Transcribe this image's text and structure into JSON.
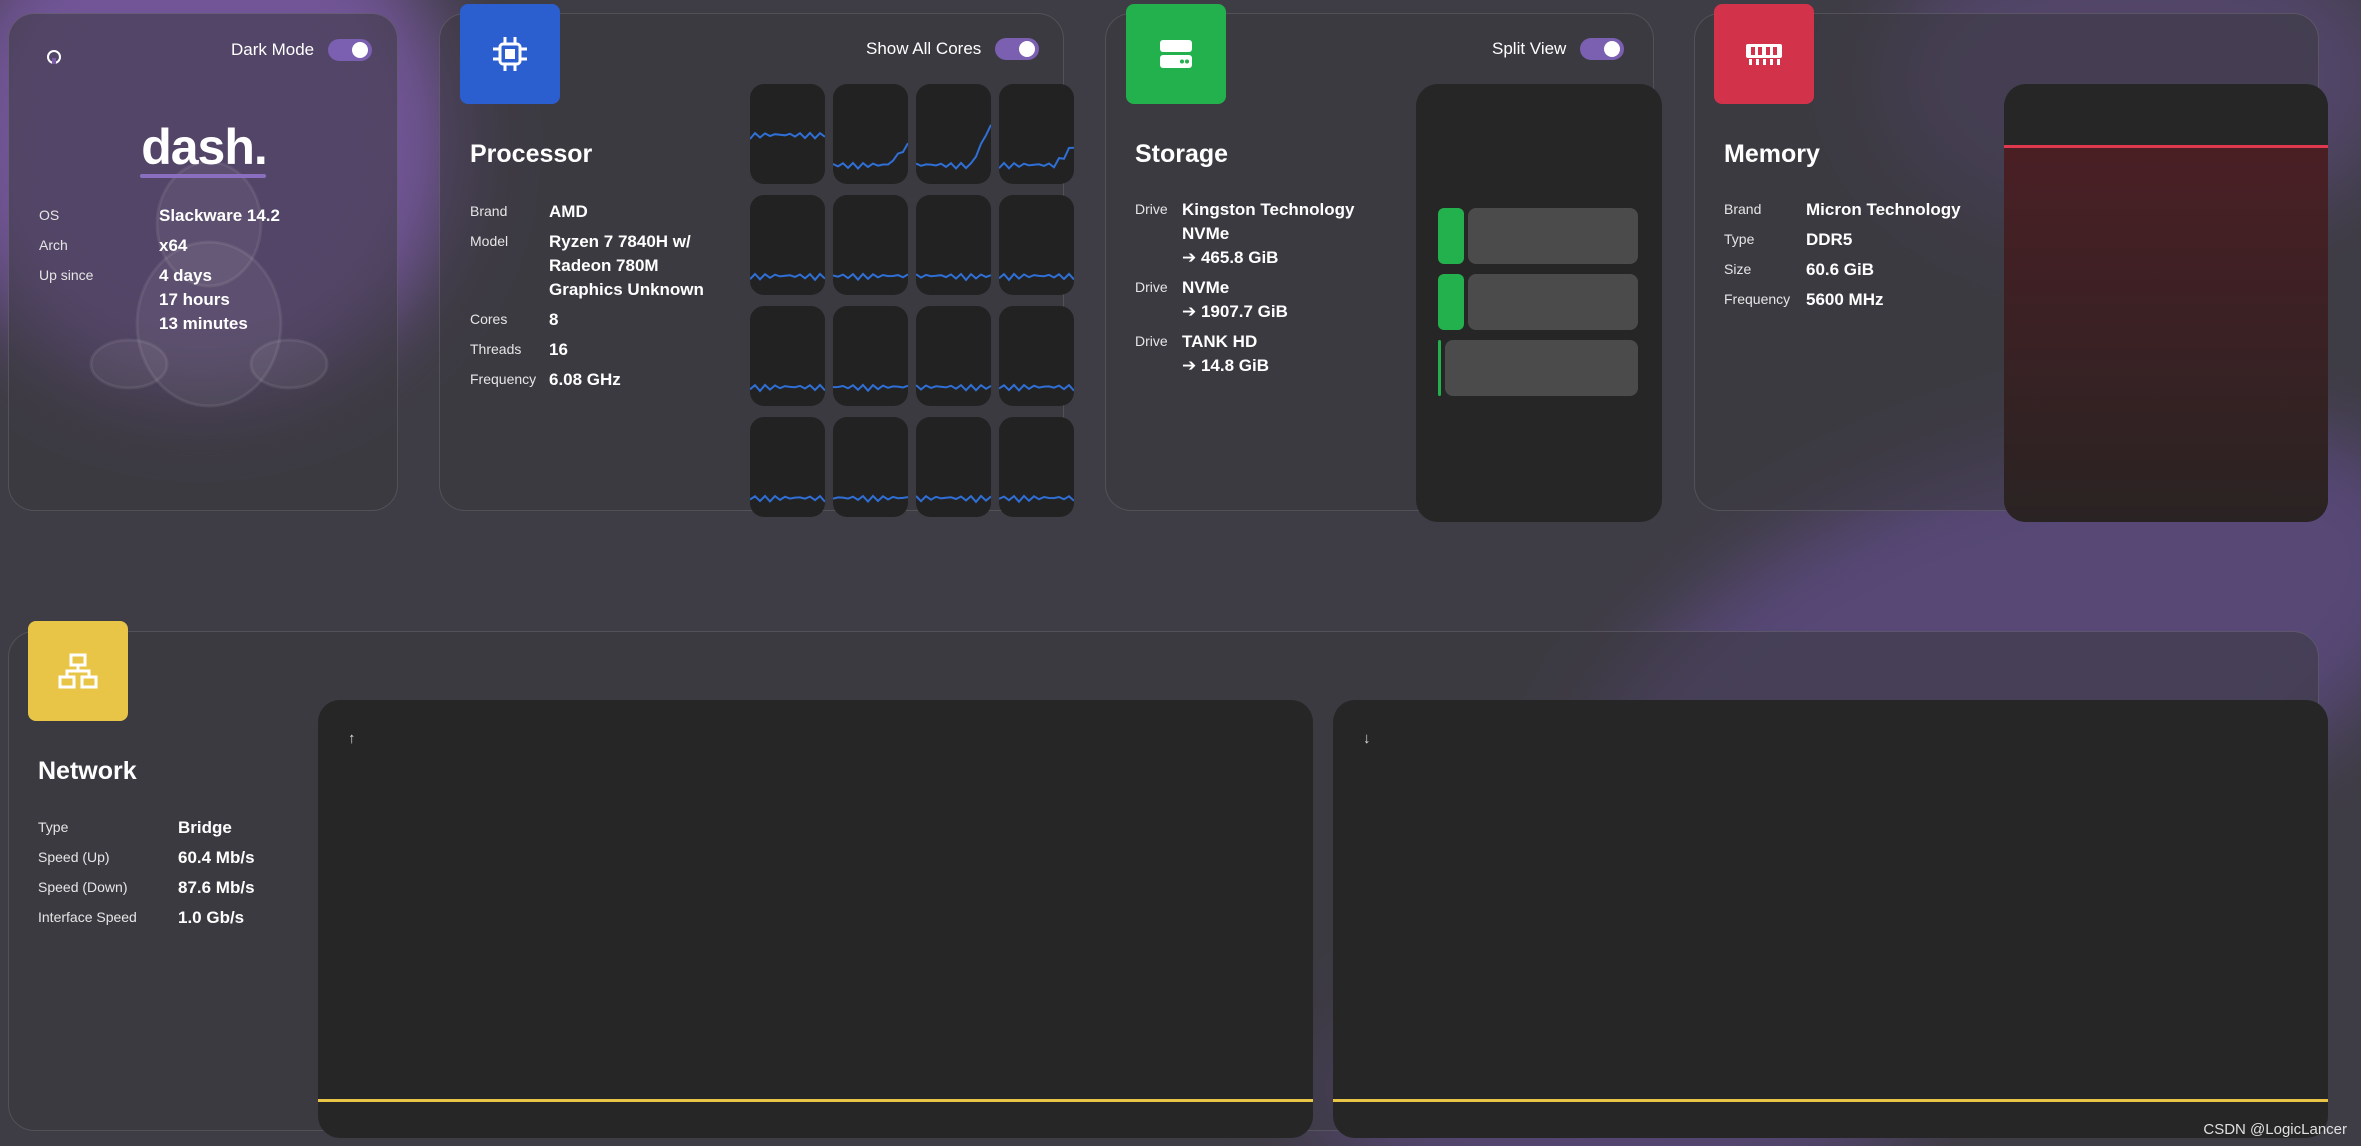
{
  "system": {
    "dark_mode_label": "Dark Mode",
    "logo": "dash.",
    "rows": [
      {
        "key": "OS",
        "value": "Slackware 14.2"
      },
      {
        "key": "Arch",
        "value": "x64"
      },
      {
        "key": "Up since",
        "value": "4 days\n17 hours\n13 minutes"
      }
    ]
  },
  "processor": {
    "title": "Processor",
    "toggle_label": "Show All Cores",
    "rows": [
      {
        "key": "Brand",
        "value": "AMD"
      },
      {
        "key": "Model",
        "value": "Ryzen 7 7840H w/\nRadeon 780M\nGraphics Unknown"
      },
      {
        "key": "Cores",
        "value": "8"
      },
      {
        "key": "Threads",
        "value": "16"
      },
      {
        "key": "Frequency",
        "value": "6.08 GHz"
      }
    ],
    "line_color": "#2f6fd6"
  },
  "storage": {
    "title": "Storage",
    "toggle_label": "Split View",
    "rows": [
      {
        "key": "Drive",
        "value": "Kingston Technology\nNVMe\n➔ 465.8 GiB"
      },
      {
        "key": "Drive",
        "value": "NVMe\n➔ 1907.7 GiB"
      },
      {
        "key": "Drive",
        "value": "TANK HD\n➔ 14.8 GiB"
      }
    ],
    "used_fraction": [
      0.13,
      0.13,
      0.01
    ]
  },
  "memory": {
    "title": "Memory",
    "rows": [
      {
        "key": "Brand",
        "value": "Micron Technology"
      },
      {
        "key": "Type",
        "value": "DDR5"
      },
      {
        "key": "Size",
        "value": "60.6 GiB"
      },
      {
        "key": "Frequency",
        "value": "5600 MHz"
      }
    ],
    "accent": "#e0384f"
  },
  "network": {
    "title": "Network",
    "rows": [
      {
        "key": "Type",
        "value": "Bridge"
      },
      {
        "key": "Speed (Up)",
        "value": "60.4 Mb/s"
      },
      {
        "key": "Speed (Down)",
        "value": "87.6 Mb/s"
      },
      {
        "key": "Interface Speed",
        "value": "1.0 Gb/s"
      }
    ],
    "up_arrow": "↑",
    "down_arrow": "↓",
    "accent": "#e8c547"
  },
  "colors": {
    "processor_badge": "#2b5fd0",
    "storage_badge": "#22b14c",
    "memory_badge": "#d2324a",
    "network_badge": "#e8c547"
  },
  "watermark": "CSDN @LogicLancer"
}
